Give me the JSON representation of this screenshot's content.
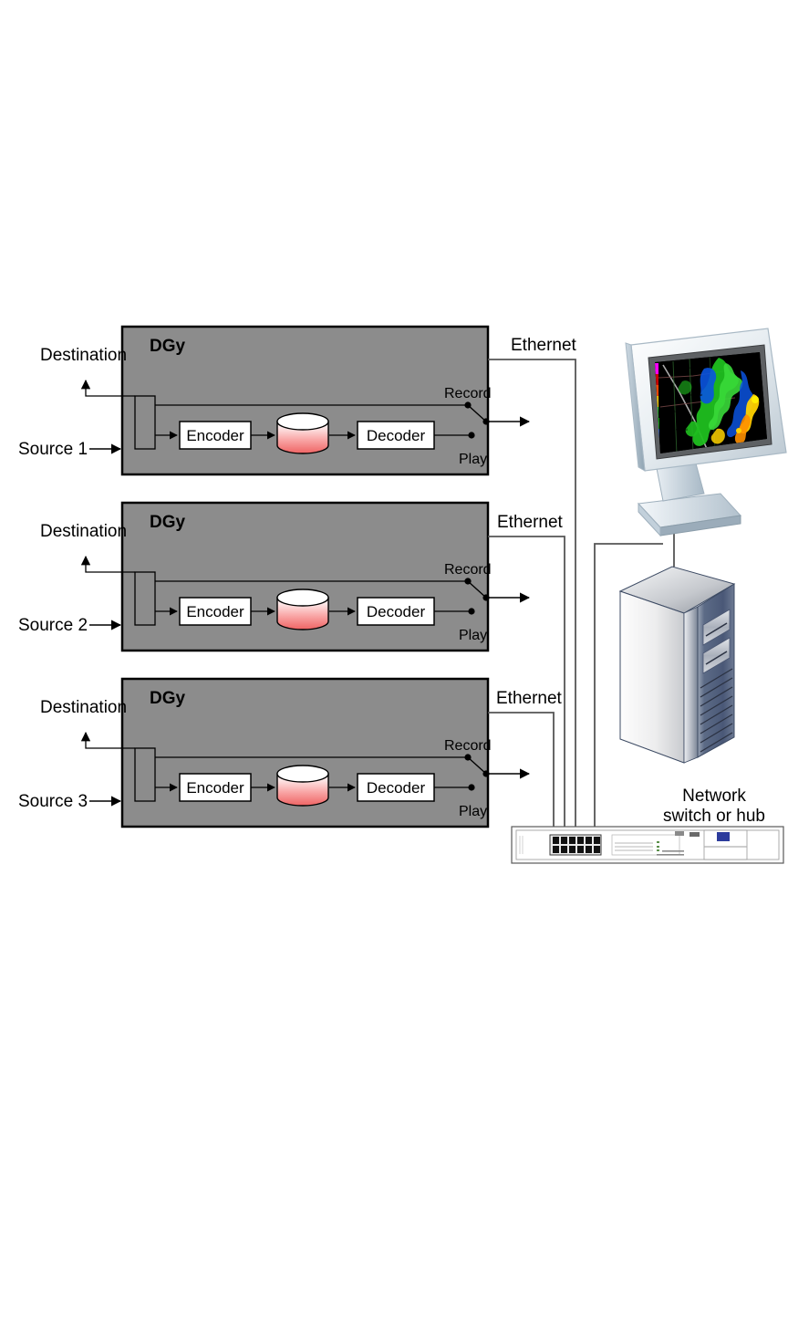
{
  "diagram": {
    "title": "DGy multi-channel record and play network diagram",
    "background_color": "#ffffff",
    "channels": [
      {
        "device_label": "DGy",
        "source_label": "Source 1",
        "destination_label": "Destination",
        "encoder_label": "Encoder",
        "decoder_label": "Decoder",
        "storage_icon": "disk-cylinder-icon",
        "switch_record_label": "Record",
        "switch_play_label": "Play",
        "ethernet_label": "Ethernet"
      },
      {
        "device_label": "DGy",
        "source_label": "Source 2",
        "destination_label": "Destination",
        "encoder_label": "Encoder",
        "decoder_label": "Decoder",
        "storage_icon": "disk-cylinder-icon",
        "switch_record_label": "Record",
        "switch_play_label": "Play",
        "ethernet_label": "Ethernet"
      },
      {
        "device_label": "DGy",
        "source_label": "Source 3",
        "destination_label": "Destination",
        "encoder_label": "Encoder",
        "decoder_label": "Decoder",
        "storage_icon": "disk-cylinder-icon",
        "switch_record_label": "Record",
        "switch_play_label": "Play",
        "ethernet_label": "Ethernet"
      }
    ],
    "network": {
      "switch_label_line1": "Network",
      "switch_label_line2": "switch or hub",
      "switch_icon": "network-switch-icon",
      "server_icon": "tower-server-icon",
      "monitor_icon": "lcd-monitor-icon",
      "monitor_screen_content": "weather-radar-map"
    },
    "colors": {
      "device_fill": "#8c8c8c",
      "device_stroke": "#000000",
      "block_fill": "#ffffff",
      "block_stroke": "#000000",
      "disk_top": "#ffffff",
      "disk_body_top": "#ffffff",
      "disk_body_bottom": "#f26d6d",
      "line": "#404040",
      "text": "#000000"
    }
  }
}
